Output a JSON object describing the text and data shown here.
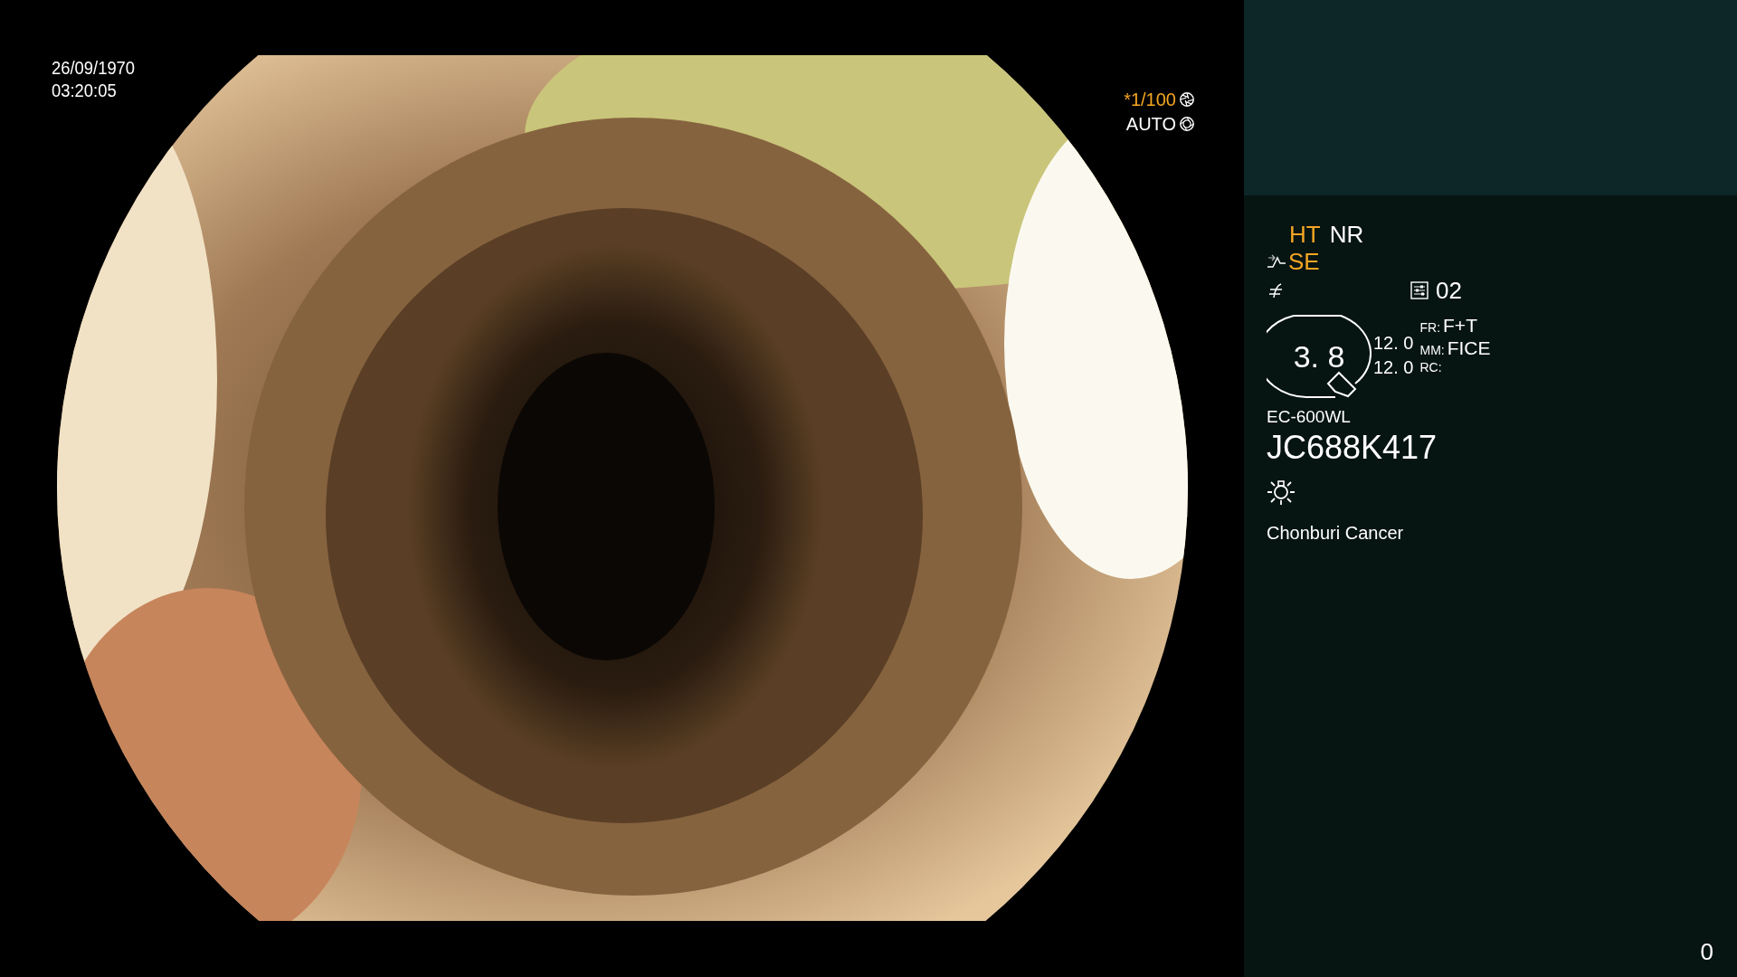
{
  "date": "26/09/1970",
  "time": "03:20:05",
  "shutter": {
    "speed": "*1/100",
    "mode": "AUTO"
  },
  "panel": {
    "enhancements": [
      {
        "label": "HT",
        "active": true
      },
      {
        "label": "NR",
        "active": false
      }
    ],
    "structure": {
      "label": "SE",
      "active": true
    },
    "preset": "02",
    "zoom": "3. 8",
    "readings": [
      "12. 0",
      "12. 0"
    ],
    "modes": [
      {
        "key": "FR:",
        "value": "F+T"
      },
      {
        "key": "MM:",
        "value": "FICE"
      },
      {
        "key": "RC:"
      }
    ],
    "scope_model": "EC-600WL",
    "serial": "JC688K417",
    "institution": "Chonburi Cancer"
  },
  "counter": "0"
}
